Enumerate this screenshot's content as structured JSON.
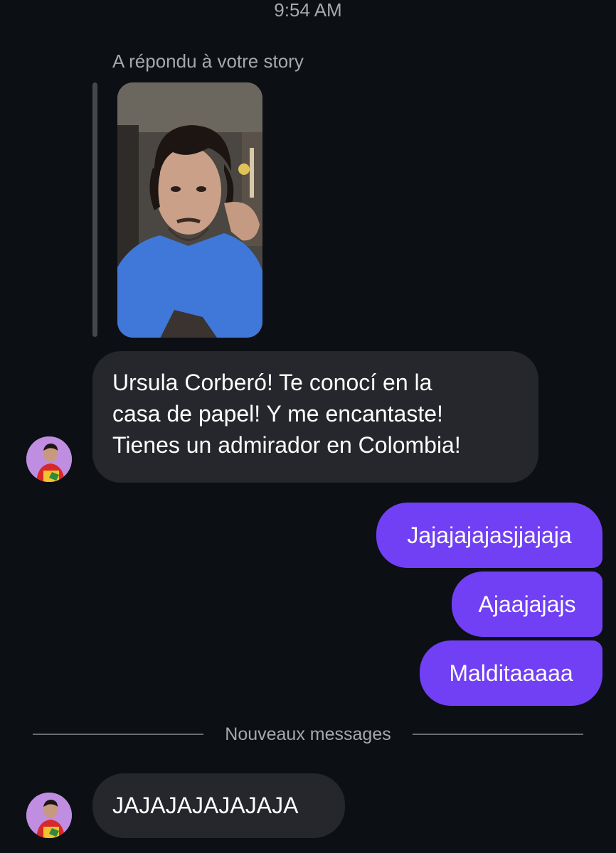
{
  "header": {
    "timestamp": "9:54 AM"
  },
  "story_reply": {
    "label": "A répondu à votre story"
  },
  "messages": [
    {
      "direction": "incoming",
      "lines": [
        "Ursula Corberó! Te conocí en la",
        "casa de papel! Y me encantaste!",
        "Tienes un admirador en Colombia!"
      ]
    },
    {
      "direction": "outgoing",
      "text": "Jajajajajasjjajaja"
    },
    {
      "direction": "outgoing",
      "text": "Ajaajajajs"
    },
    {
      "direction": "outgoing",
      "text": "Malditaaaaa"
    },
    {
      "direction": "incoming",
      "text": "JAJAJAJAJAJAJA"
    }
  ],
  "divider": {
    "label": "Nouveaux messages"
  },
  "colors": {
    "background": "#0c0f14",
    "incoming_bubble": "#25272c",
    "outgoing_bubble": "#7140f4",
    "muted_text": "#a6a8ad"
  },
  "icons": {
    "avatar": "contact-avatar",
    "story": "story-thumbnail"
  }
}
